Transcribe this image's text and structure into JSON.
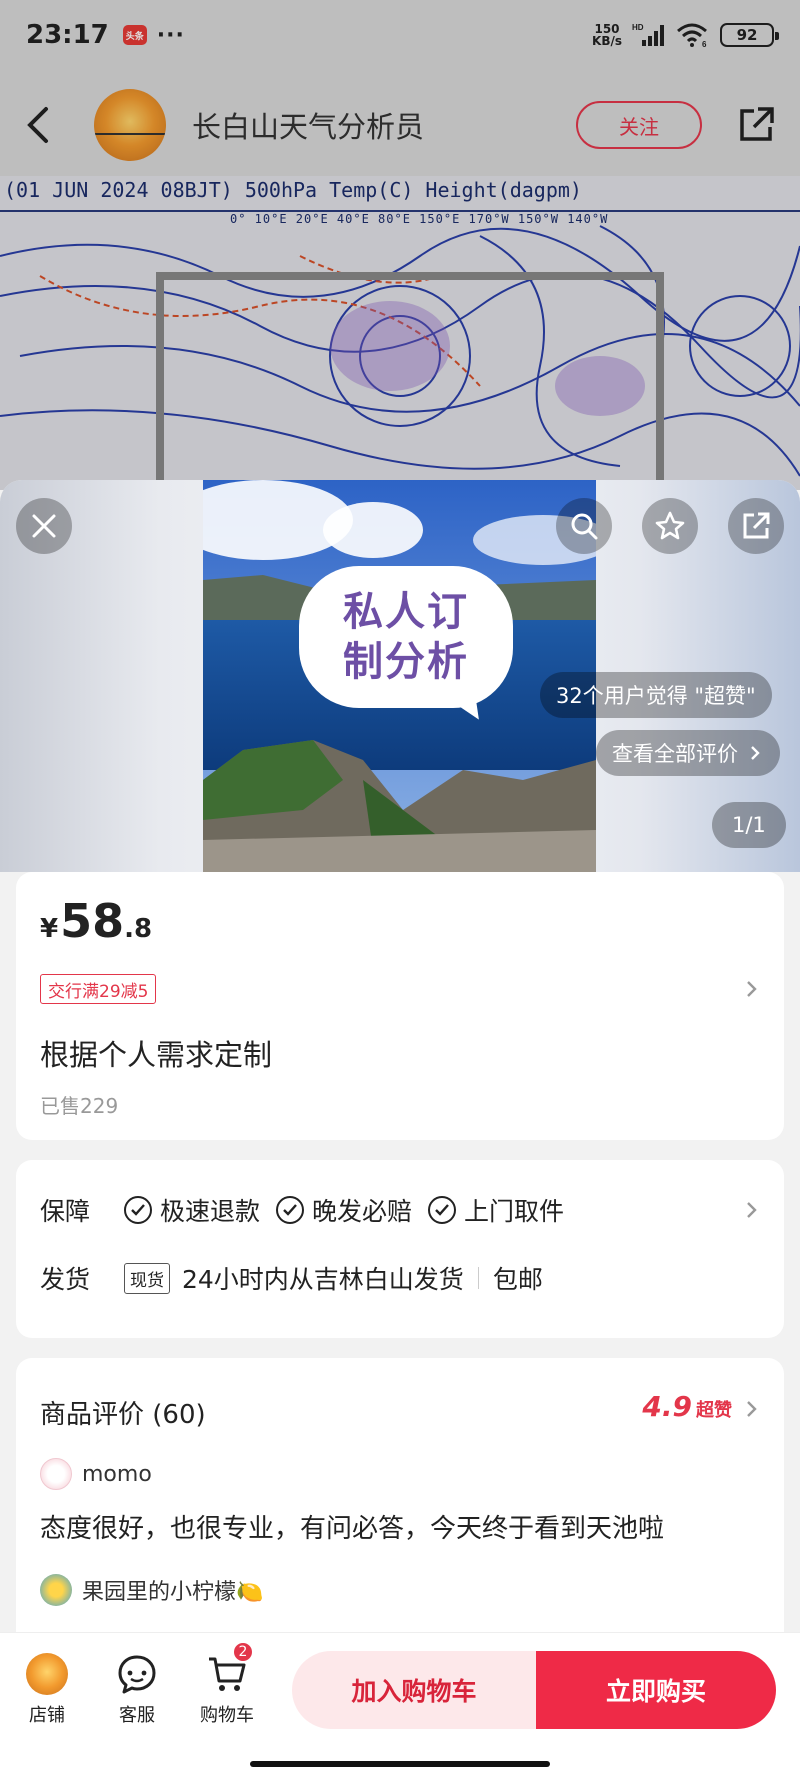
{
  "status_bar": {
    "time": "23:17",
    "app_badge": "头条",
    "more": "···",
    "net_speed_value": "150",
    "net_speed_unit": "KB/s",
    "signal_label": "HD",
    "wifi_label": "6",
    "battery": "92"
  },
  "background_page": {
    "account_name": "长白山天气分析员",
    "follow_label": "关注",
    "map_title": "(01 JUN 2024 08BJT) 500hPa Temp(C) Height(dagpm)",
    "map_ticks": "0°    10°E  20°E  40°E  80°E   150°E 170°W    150°W        140°W"
  },
  "hero": {
    "bubble_text": "私人订制分析",
    "praise_text": "32个用户觉得 \"超赞\"",
    "all_reviews_label": "查看全部评价",
    "page_indicator": "1/1"
  },
  "product": {
    "currency": "¥",
    "price_int": "58",
    "price_dec": ".8",
    "promo_tag": "交行满29减5",
    "title": "根据个人需求定制",
    "sold": "已售229"
  },
  "service": {
    "guarantee_label": "保障",
    "guarantees": [
      "极速退款",
      "晚发必赔",
      "上门取件"
    ],
    "shipping_label": "发货",
    "stock_tag": "现货",
    "shipping_text": "24小时内从吉林白山发货",
    "free_shipping": "包邮"
  },
  "reviews": {
    "title": "商品评价 (60)",
    "score": "4.9",
    "score_word": "超赞",
    "items": [
      {
        "user": "momo",
        "text": "态度很好，也很专业，有问必答，今天终于看到天池啦"
      },
      {
        "user": "果园里的小柠檬🍋",
        "text": ""
      }
    ]
  },
  "bottom_bar": {
    "store_label": "店铺",
    "service_label": "客服",
    "cart_label": "购物车",
    "cart_count": "2",
    "add_to_cart": "加入购物车",
    "buy_now": "立即购买"
  },
  "colors": {
    "accent": "#ef2a47",
    "accent_light": "#fde8ea",
    "background": "#f2f2f2"
  }
}
